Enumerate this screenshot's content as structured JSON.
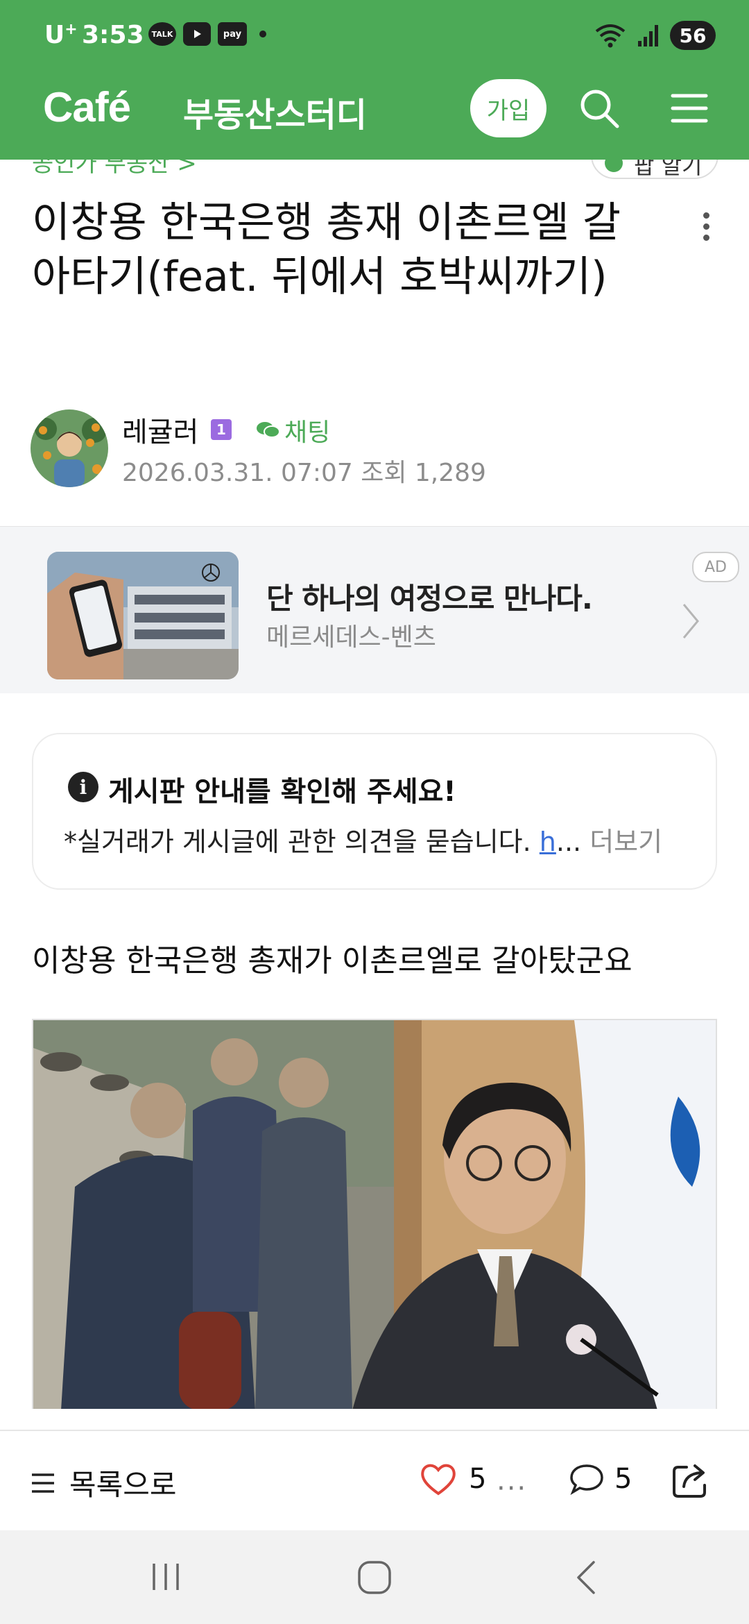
{
  "status_bar": {
    "carrier": "U",
    "carrier_plus": "+",
    "time": "3:53",
    "talk_icon_label": "TALK",
    "pay_icon_label": "pay",
    "battery": "56"
  },
  "app_bar": {
    "logo": "Café",
    "cafe_name": "부동산스터디",
    "join_label": "가입"
  },
  "post": {
    "board_label": "공인가 부동산 >",
    "follow_label": "팝 알기",
    "title": "이창용 한국은행 총재 이촌르엘 갈아타기(feat. 뒤에서 호박씨까기)",
    "author": "레귤러",
    "level": "1",
    "chat_label": "채팅",
    "meta": "2026.03.31. 07:07  조회 1,289",
    "body_text": "이창용 한국은행 총재가 이촌르엘로 갈아탔군요"
  },
  "ad": {
    "title": "단 하나의 여정으로 만나다.",
    "subtitle": "메르세데스-벤츠",
    "badge": "AD"
  },
  "notice": {
    "title": "게시판 안내를 확인해 주세요!",
    "body": "*실거래가 게시글에 관한 의견을 묻습니다. ",
    "link": "h",
    "ellipsis": "... ",
    "more": "더보기"
  },
  "bottom_bar": {
    "list_label": "목록으로",
    "like_count": "5",
    "comment_count": "5"
  },
  "colors": {
    "brand_green": "#4caa57",
    "link_blue": "#3a6fd8",
    "like_red": "#e0443a"
  }
}
